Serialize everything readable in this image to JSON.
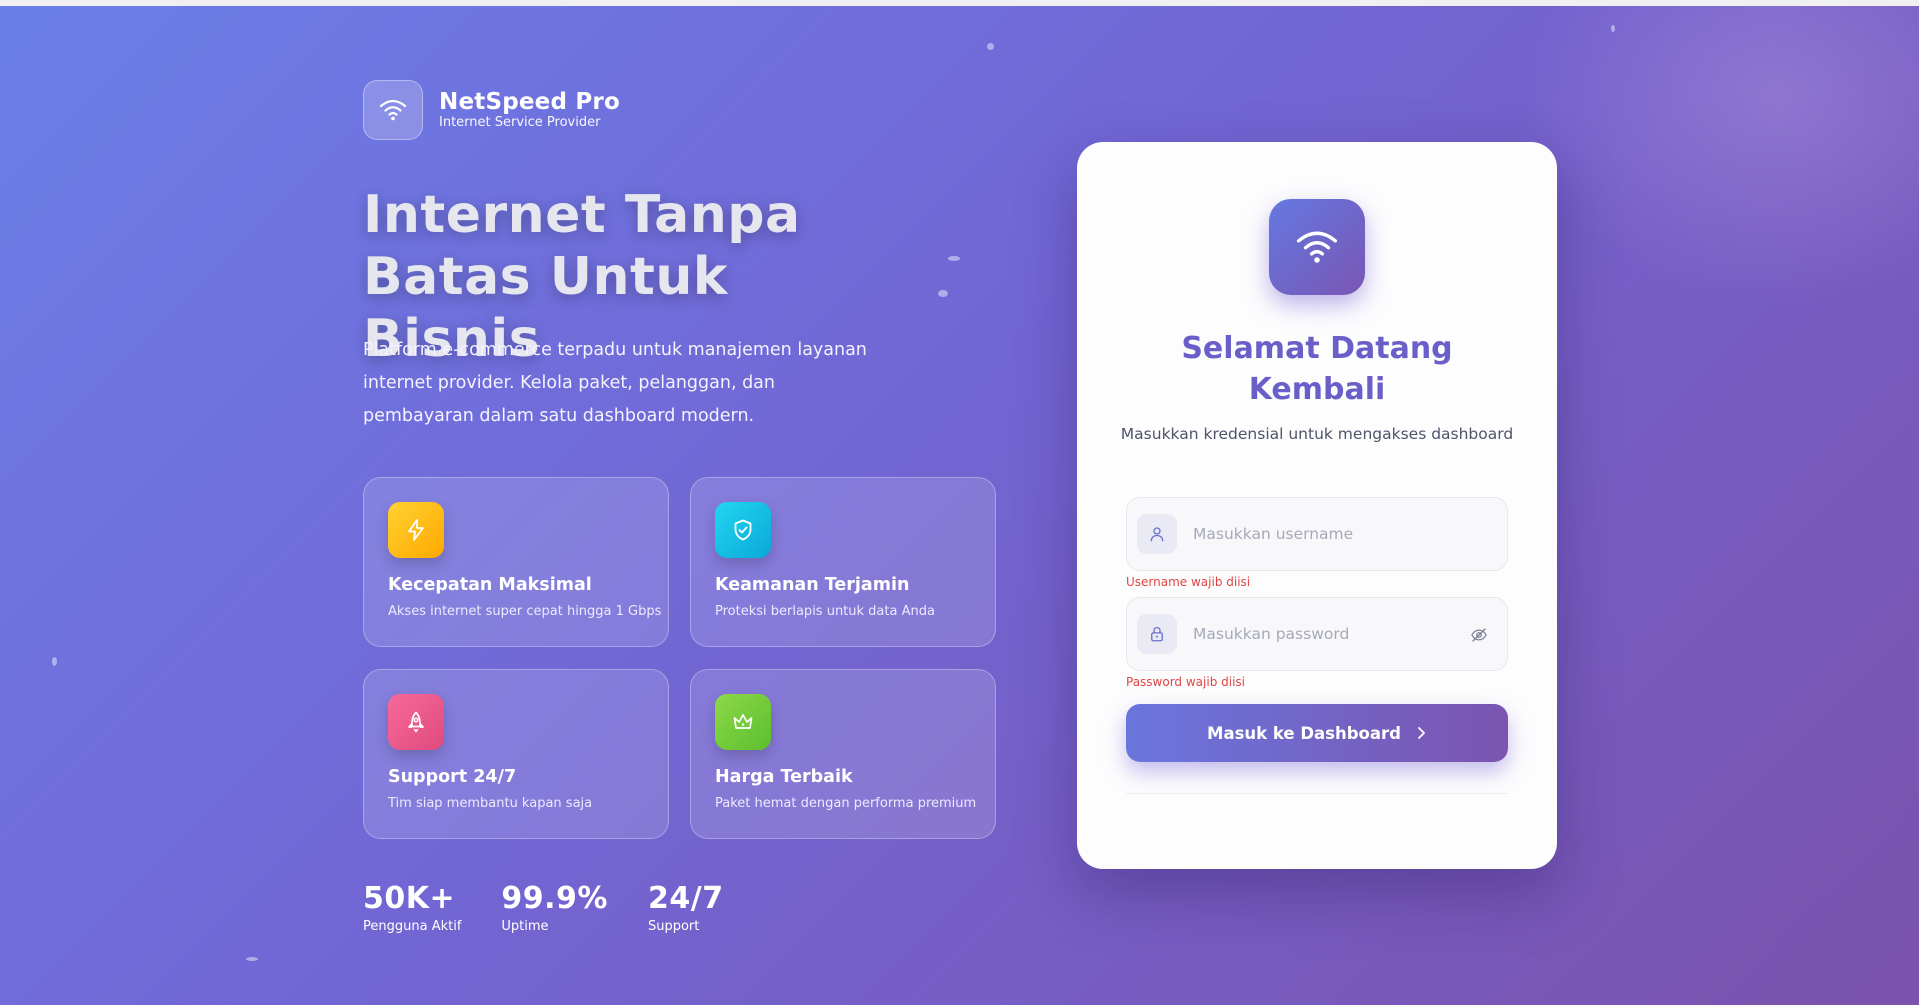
{
  "brand": {
    "name": "NetSpeed Pro",
    "tagline": "Internet Service Provider",
    "icon": "wifi-icon"
  },
  "hero": {
    "line1": "Internet Tanpa",
    "line2": "Batas Untuk Bisnis",
    "description": "Platform e-commerce terpadu untuk manajemen layanan internet provider. Kelola paket, pelanggan, dan pembayaran dalam satu dashboard modern."
  },
  "features": [
    {
      "title": "Kecepatan Maksimal",
      "desc": "Akses internet super cepat hingga 1 Gbps",
      "icon": "lightning-icon",
      "color": "#ffc107"
    },
    {
      "title": "Keamanan Terjamin",
      "desc": "Proteksi berlapis untuk data Anda",
      "icon": "shield-check-icon",
      "color": "#13c6e6"
    },
    {
      "title": "Support 24/7",
      "desc": "Tim siap membantu kapan saja",
      "icon": "rocket-icon",
      "color": "#f2588c"
    },
    {
      "title": "Harga Terbaik",
      "desc": "Paket hemat dengan performa premium",
      "icon": "crown-icon",
      "color": "#7fd13b"
    }
  ],
  "stats": [
    {
      "value": "50K+",
      "label": "Pengguna Aktif"
    },
    {
      "value": "99.9%",
      "label": "Uptime"
    },
    {
      "value": "24/7",
      "label": "Support"
    }
  ],
  "login": {
    "title_line1": "Selamat Datang",
    "title_line2": "Kembali",
    "subtitle": "Masukkan kredensial untuk mengakses dashboard",
    "username": {
      "placeholder": "Masukkan username",
      "value": "",
      "error": "Username wajib diisi"
    },
    "password": {
      "placeholder": "Masukkan password",
      "value": "",
      "error": "Password wajib diisi"
    },
    "submit_label": "Masuk ke Dashboard"
  },
  "colors": {
    "accent": "#6a5ec8",
    "error": "#e04545",
    "gradient_start": "#6b7ee8",
    "gradient_end": "#7b52ad"
  }
}
